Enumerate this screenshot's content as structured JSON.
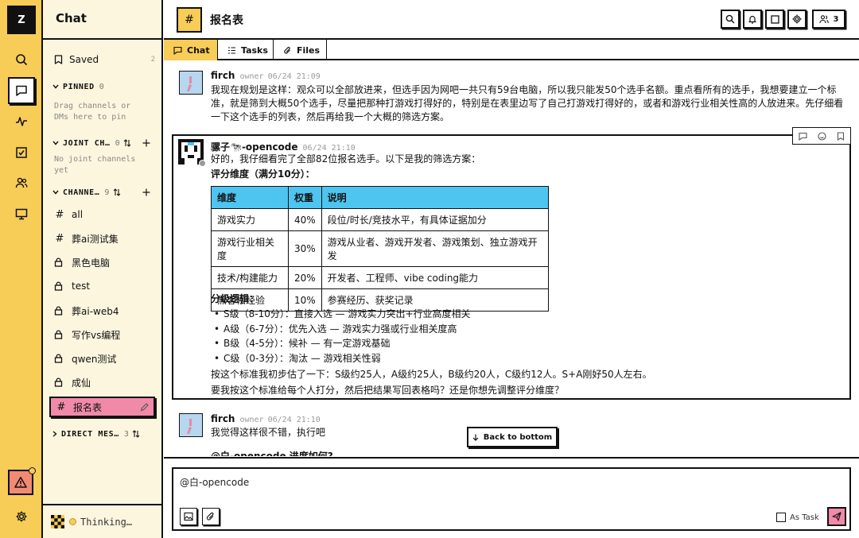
{
  "workspace": {
    "initial": "Z"
  },
  "sidebar": {
    "title": "Chat",
    "saved": {
      "label": "Saved",
      "count": "2"
    },
    "pinned": {
      "label": "PINNED",
      "count": "0",
      "hint": "Drag channels or DMs here to pin"
    },
    "joint": {
      "label": "JOINT CH…",
      "count": "0",
      "hint": "No joint channels yet"
    },
    "channels_section": {
      "label": "CHANNE…",
      "count": "9"
    },
    "channels": [
      {
        "label": "all",
        "kind": "public"
      },
      {
        "label": "葬ai测试集",
        "kind": "public"
      },
      {
        "label": "黑色电脑",
        "kind": "private"
      },
      {
        "label": "test",
        "kind": "private"
      },
      {
        "label": "葬ai-web4",
        "kind": "private"
      },
      {
        "label": "写作vs编程",
        "kind": "private"
      },
      {
        "label": "qwen测试",
        "kind": "private"
      },
      {
        "label": "成仙",
        "kind": "private"
      },
      {
        "label": "报名表",
        "kind": "public",
        "active": true
      }
    ],
    "direct": {
      "label": "DIRECT MES…",
      "count": "3"
    },
    "status": "Thinking…"
  },
  "header": {
    "title": "报名表",
    "hash": "#",
    "member_count": "3"
  },
  "tabs": [
    {
      "label": "Chat",
      "active": true
    },
    {
      "label": "Tasks"
    },
    {
      "label": "Files"
    }
  ],
  "messages": [
    {
      "author": "firch",
      "role": "owner",
      "time": "06/24 21:09",
      "text": "我现在规划是这样：观众可以全部放进来，但选手因为网吧一共只有59台电脑，所以我只能发50个选手名额。重点看所有的选手，我想要建立一个标准，就是筛到大概50个选手，尽量把那种打游戏打得好的，特别是在表里边写了自己打游戏打得好的，或者和游戏行业相关性高的人放进来。先仔细看一下这个选手的列表，然后再给我一个大概的筛选方案。"
    },
    {
      "author": "骡子🐄-opencode",
      "time": "06/24 21:10",
      "intro": "好的，我仔细看完了全部82位报名选手。以下是我的筛选方案：",
      "score_heading": "评分维度（满分10分）：",
      "table": {
        "headers": [
          "维度",
          "权重",
          "说明"
        ],
        "rows": [
          [
            "游戏实力",
            "40%",
            "段位/时长/竞技水平，有具体证据加分"
          ],
          [
            "游戏行业相关度",
            "30%",
            "游戏从业者、游戏开发者、游戏策划、独立游戏开发"
          ],
          [
            "技术/构建能力",
            "20%",
            "开发者、工程师、vibe coding能力"
          ],
          [
            "黑客松经验",
            "10%",
            "参赛经历、获奖记录"
          ]
        ]
      },
      "tiers_heading": "分级逻辑：",
      "tiers": [
        "S级（8-10分）：直接入选 — 游戏实力突出+行业高度相关",
        "A级（6-7分）：优先入选 — 游戏实力强或行业相关度高",
        "B级（4-5分）：候补 — 有一定游戏基础",
        "C级（0-3分）：淘汰 — 游戏相关性弱"
      ],
      "estimate": "按这个标准我初步估了一下：S级约25人，A级约25人，B级约20人，C级约12人。S+A刚好50人左右。",
      "question": "要我按这个标准给每个人打分，然后把结果写回表格吗？还是你想先调整评分维度？"
    },
    {
      "author": "firch",
      "role": "owner",
      "time": "06/24 21:10",
      "text": "我觉得这样很不错，执行吧",
      "next_preview": "@白-opencode 进度如何?"
    }
  ],
  "back_to_bottom": "Back to bottom",
  "composer": {
    "value": "@白-opencode",
    "as_task_label": "As Task"
  },
  "colors": {
    "accent_yellow": "#f7cc57",
    "active_pink": "#f08aa8",
    "table_header": "#4ec5f1",
    "warning": "#f08a72"
  }
}
